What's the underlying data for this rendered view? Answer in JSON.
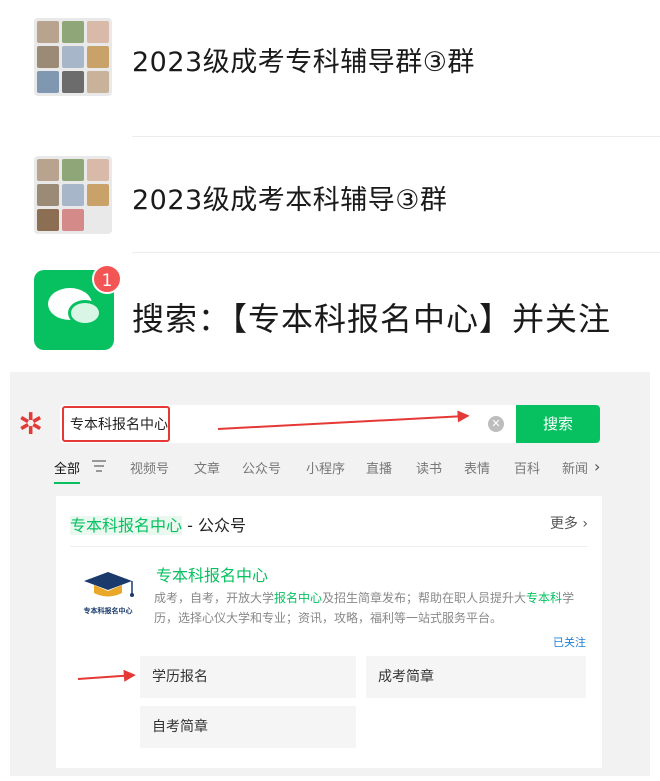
{
  "chats": [
    {
      "name": "2023级成考专科辅导群③群"
    },
    {
      "name": "2023级成考本科辅导③群"
    }
  ],
  "notice": {
    "badge": "1",
    "text": "搜索：【专本科报名中心】并关注"
  },
  "search": {
    "value": "专本科报名中心",
    "button": "搜索"
  },
  "tabs": [
    "全部",
    "视频号",
    "文章",
    "公众号",
    "小程序",
    "直播",
    "读书",
    "表情",
    "百科",
    "新闻"
  ],
  "result": {
    "header_highlight": "专本科报名中心",
    "header_suffix": " - 公众号",
    "more": "更多",
    "logo_text": "专本科报名中心",
    "account_name": "专本科报名中心",
    "desc_1": "成考，自考，开放大学",
    "desc_hl_1": "报名中心",
    "desc_2": "及招生简章发布；帮助在职人员提升大",
    "desc_hl_2": "专本科",
    "desc_3": "学历，选择心仪大学和专业；资讯，攻略，福利等一站式服务平台。",
    "followed": "已关注",
    "menu": [
      "学历报名",
      "成考简章",
      "自考简章"
    ]
  },
  "colors": {
    "accent": "#07c160",
    "marker": "#e53935",
    "badge": "#f35555"
  }
}
